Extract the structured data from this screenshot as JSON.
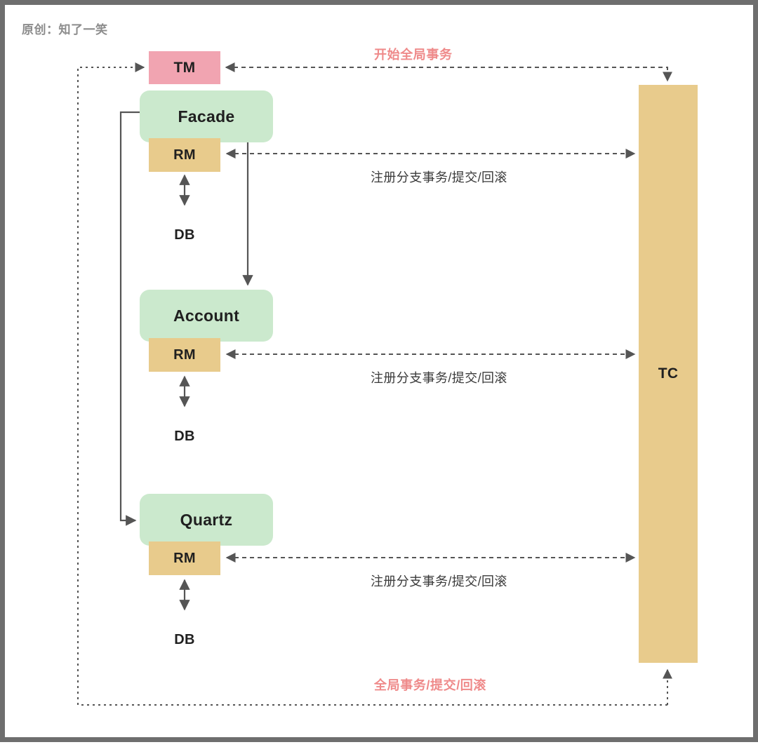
{
  "watermark": "原创：知了一笑",
  "colors": {
    "service_fill": "#cbe9cd",
    "tm_fill": "#f1a4b1",
    "rm_fill": "#e8cb8c",
    "tc_fill": "#e8cb8c",
    "db_fill": "#f6d0d6",
    "db_stroke": "#6b6b6b",
    "line": "#555555",
    "accent_text": "#ef8a8a",
    "label_text": "#3a3a3a",
    "frame": "#6e6e6e"
  },
  "nodes": {
    "tm": {
      "label": "TM"
    },
    "tc": {
      "label": "TC"
    },
    "facade": {
      "label": "Facade"
    },
    "account": {
      "label": "Account"
    },
    "quartz": {
      "label": "Quartz"
    },
    "facade_rm": {
      "label": "RM"
    },
    "account_rm": {
      "label": "RM"
    },
    "quartz_rm": {
      "label": "RM"
    },
    "facade_db": {
      "label": "DB"
    },
    "account_db": {
      "label": "DB"
    },
    "quartz_db": {
      "label": "DB"
    }
  },
  "edge_labels": {
    "begin_global_tx": "开始全局事务",
    "register_branch_facade": "注册分支事务/提交/回滚",
    "register_branch_account": "注册分支事务/提交/回滚",
    "register_branch_quartz": "注册分支事务/提交/回滚",
    "global_tx_commit_rollback": "全局事务/提交/回滚"
  }
}
